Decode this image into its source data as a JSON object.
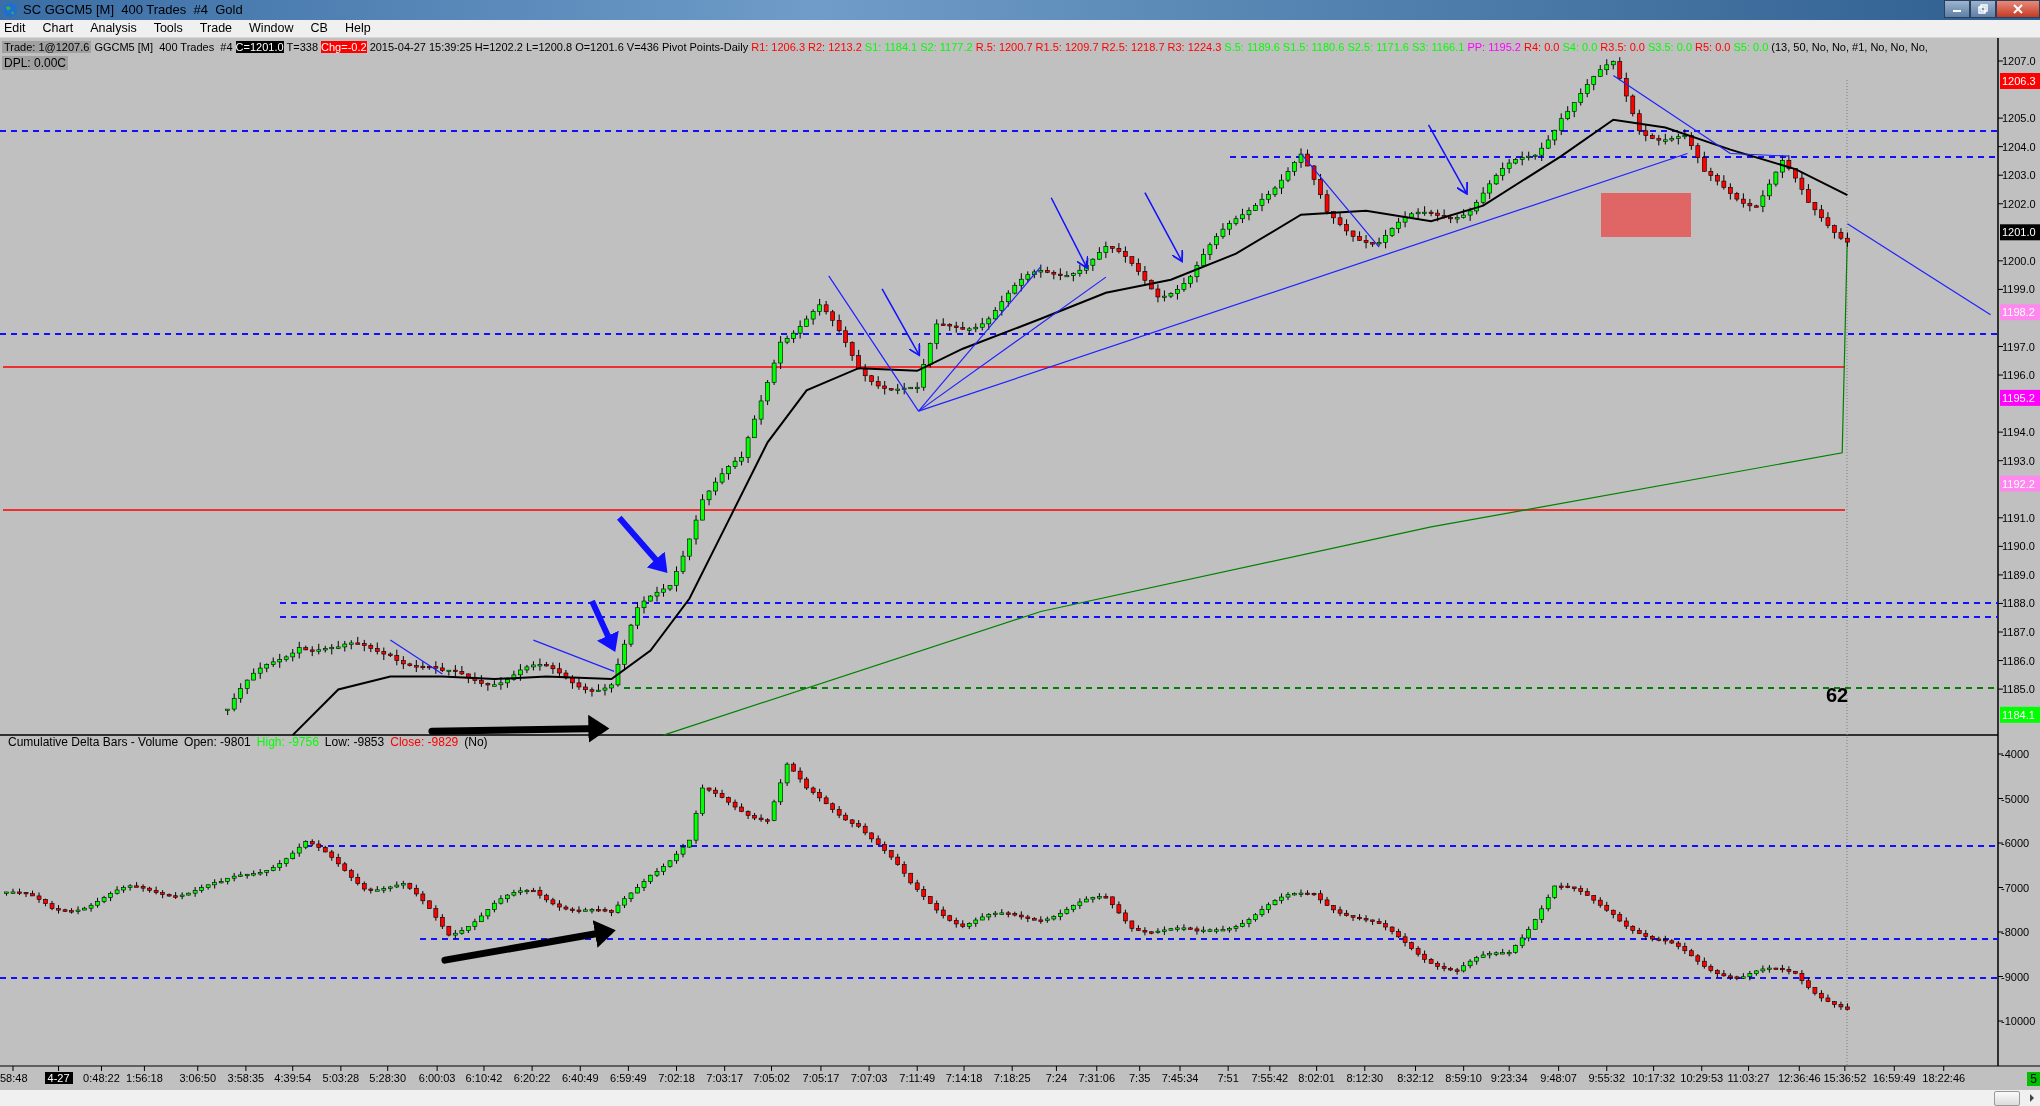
{
  "window": {
    "title": "SC GGCM5 [M]  400 Trades  #4  Gold"
  },
  "menu": [
    "Edit",
    "Chart",
    "Analysis",
    "Tools",
    "Trade",
    "Window",
    "CB",
    "Help"
  ],
  "info_bar": [
    {
      "text": "Trade: 1@1207.6",
      "kind": "label"
    },
    {
      "text": "GGCM5 [M]  400 Trades  #4",
      "kind": "plain"
    },
    {
      "text": "C=1201.0",
      "kind": "inverse"
    },
    {
      "text": "T=338",
      "kind": "plain"
    },
    {
      "text": "Chg=-0.2",
      "kind": "alert"
    },
    {
      "text": "2015-04-27 15:39:25 H=1202.2 L=1200.8 O=1201.6 V=436 Pivot Points-Daily",
      "kind": "plain"
    },
    {
      "text": "R1: 1206.3",
      "kind": "plain",
      "color": "#ff0000"
    },
    {
      "text": "R2: 1213.2",
      "kind": "plain",
      "color": "#ff0000"
    },
    {
      "text": "S1: 1184.1",
      "kind": "plain",
      "color": "#00ff00"
    },
    {
      "text": "S2: 1177.2",
      "kind": "plain",
      "color": "#00ff00"
    },
    {
      "text": "R.5: 1200.7",
      "kind": "plain",
      "color": "#ff0000"
    },
    {
      "text": "R1.5: 1209.7",
      "kind": "plain",
      "color": "#ff0000"
    },
    {
      "text": "R2.5: 1218.7",
      "kind": "plain",
      "color": "#ff0000"
    },
    {
      "text": "R3: 1224.3",
      "kind": "plain",
      "color": "#ff0000"
    },
    {
      "text": "S.5: 1189.6",
      "kind": "plain",
      "color": "#00ff00"
    },
    {
      "text": "S1.5: 1180.6",
      "kind": "plain",
      "color": "#00ff00"
    },
    {
      "text": "S2.5: 1171.6",
      "kind": "plain",
      "color": "#00ff00"
    },
    {
      "text": "S3: 1166.1",
      "kind": "plain",
      "color": "#00ff00"
    },
    {
      "text": "PP: 1195.2",
      "kind": "plain",
      "color": "#ff00ff"
    },
    {
      "text": "R4: 0.0",
      "kind": "plain",
      "color": "#ff0000"
    },
    {
      "text": "S4: 0.0",
      "kind": "plain",
      "color": "#00ff00"
    },
    {
      "text": "R3.5: 0.0",
      "kind": "plain",
      "color": "#ff0000"
    },
    {
      "text": "S3.5: 0.0",
      "kind": "plain",
      "color": "#00ff00"
    },
    {
      "text": "R5: 0.0",
      "kind": "plain",
      "color": "#ff0000"
    },
    {
      "text": "S5: 0.0",
      "kind": "plain",
      "color": "#00ff00"
    },
    {
      "text": "(13, 50, No, No, #1, No, No, No,",
      "kind": "plain"
    }
  ],
  "dpl": "DPL: 0.00C",
  "price_axis": {
    "ticks": [
      "1207.0",
      "1205.0",
      "1204.0",
      "1203.0",
      "1202.0",
      "1200.0",
      "1199.0",
      "1197.0",
      "1196.0",
      "1194.0",
      "1193.0",
      "1191.0",
      "1190.0",
      "1189.0",
      "1188.0",
      "1187.0",
      "1186.0",
      "1185.0"
    ],
    "badges": [
      {
        "text": "1206.3",
        "color": "#ff0000"
      },
      {
        "text": "1201.0",
        "color": "#000000"
      },
      {
        "text": "1198.2",
        "color": "#ff88ee"
      },
      {
        "text": "1195.2",
        "color": "#ff00ff"
      },
      {
        "text": "1192.2",
        "color": "#ff88ee"
      },
      {
        "text": "1184.1",
        "color": "#00ff00"
      }
    ]
  },
  "annotation": "62",
  "delta_panel": {
    "title": "Cumulative Delta Bars - Volume",
    "stats": [
      {
        "text": "Open: -9801",
        "color": "#000000"
      },
      {
        "text": "High: -9756",
        "color": "#00ff00"
      },
      {
        "text": "Low: -9853",
        "color": "#000000"
      },
      {
        "text": "Close: -9829",
        "color": "#ff0000"
      },
      {
        "text": "(No)",
        "color": "#000000"
      }
    ],
    "ticks": [
      "-4000",
      "-5000",
      "-6000",
      "-7000",
      "-8000",
      "-9000",
      "-10000"
    ]
  },
  "time_axis": [
    {
      "text": "58:48",
      "kind": "time"
    },
    {
      "text": "4-27",
      "kind": "date"
    },
    {
      "text": "0:48:22",
      "kind": "time"
    },
    {
      "text": "1:56:18",
      "kind": "time"
    },
    {
      "text": "3:06:50",
      "kind": "time"
    },
    {
      "text": "3:58:35",
      "kind": "time"
    },
    {
      "text": "4:39:54",
      "kind": "time"
    },
    {
      "text": "5:03:28",
      "kind": "time"
    },
    {
      "text": "5:28:30",
      "kind": "time"
    },
    {
      "text": "6:00:03",
      "kind": "time"
    },
    {
      "text": "6:10:42",
      "kind": "time"
    },
    {
      "text": "6:20:22",
      "kind": "time"
    },
    {
      "text": "6:40:49",
      "kind": "time"
    },
    {
      "text": "6:59:49",
      "kind": "time"
    },
    {
      "text": "7:02:18",
      "kind": "time"
    },
    {
      "text": "7:03:17",
      "kind": "time"
    },
    {
      "text": "7:05:02",
      "kind": "time"
    },
    {
      "text": "7:05:17",
      "kind": "time"
    },
    {
      "text": "7:07:03",
      "kind": "time"
    },
    {
      "text": "7:11:49",
      "kind": "time"
    },
    {
      "text": "7:14:18",
      "kind": "time"
    },
    {
      "text": "7:18:25",
      "kind": "time"
    },
    {
      "text": "7:24",
      "kind": "time"
    },
    {
      "text": "7:31:06",
      "kind": "time"
    },
    {
      "text": "7:35",
      "kind": "time"
    },
    {
      "text": "7:45:34",
      "kind": "time"
    },
    {
      "text": "7:51",
      "kind": "time"
    },
    {
      "text": "7:55:42",
      "kind": "time"
    },
    {
      "text": "8:02:01",
      "kind": "time"
    },
    {
      "text": "8:12:30",
      "kind": "time"
    },
    {
      "text": "8:32:12",
      "kind": "time"
    },
    {
      "text": "8:59:10",
      "kind": "time"
    },
    {
      "text": "9:23:34",
      "kind": "time"
    },
    {
      "text": "9:48:07",
      "kind": "time"
    },
    {
      "text": "9:55:32",
      "kind": "time"
    },
    {
      "text": "10:17:32",
      "kind": "time"
    },
    {
      "text": "10:29:53",
      "kind": "time"
    },
    {
      "text": "11:03:27",
      "kind": "time"
    },
    {
      "text": "12:36:46",
      "kind": "time"
    },
    {
      "text": "15:36:52",
      "kind": "time"
    },
    {
      "text": "16:59:49",
      "kind": "time"
    },
    {
      "text": "18:22:46",
      "kind": "time"
    }
  ],
  "corner_badge": "5"
}
